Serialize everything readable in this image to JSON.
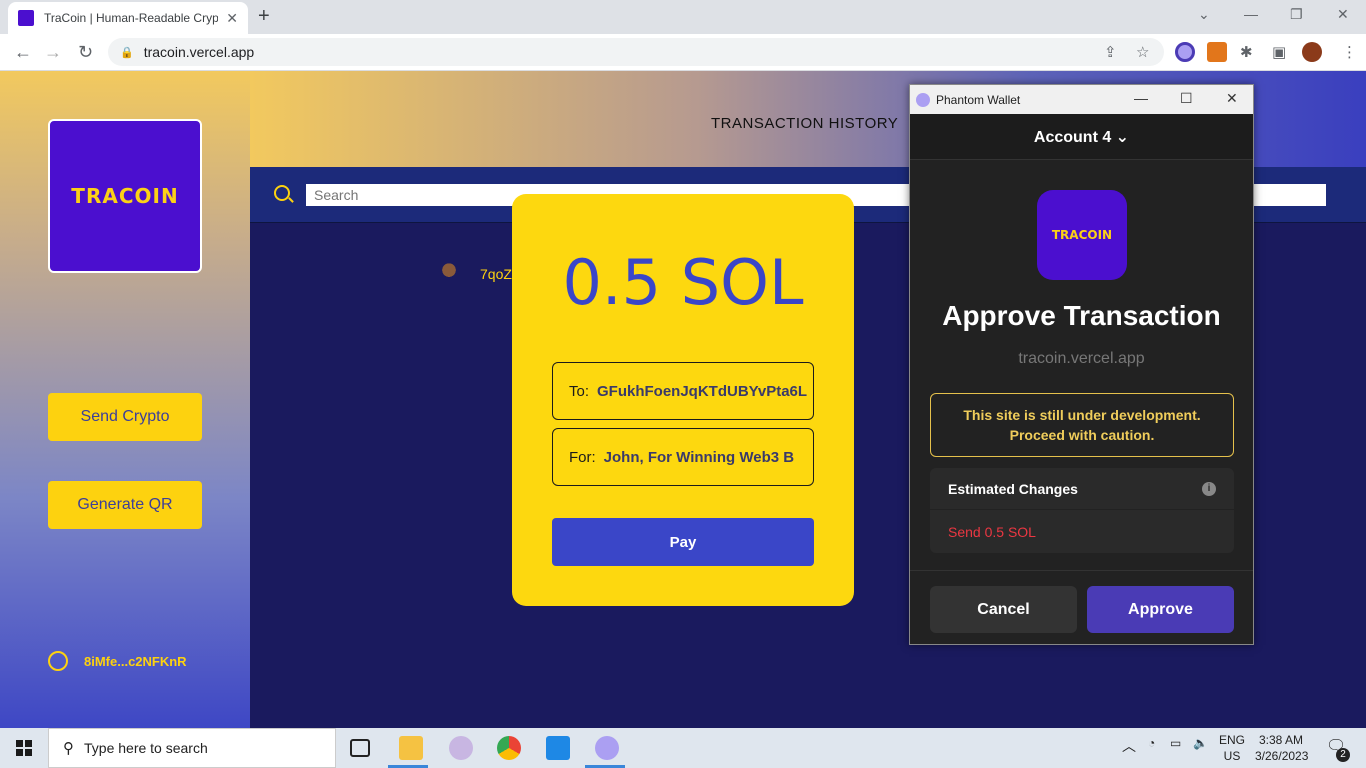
{
  "browser": {
    "tab_title": "TraCoin | Human-Readable Crypto",
    "tab_close": "✕",
    "new_tab": "+",
    "url": "tracoin.vercel.app"
  },
  "sidebar": {
    "logo_text": "TRACOIN",
    "send_crypto": "Send Crypto",
    "generate_qr": "Generate QR",
    "wallet_address": "8iMfe...c2NFKnR"
  },
  "header": {
    "title": "TRANSACTION HISTORY"
  },
  "search": {
    "placeholder": "Search"
  },
  "history": {
    "item_text": "7qoZ"
  },
  "payment": {
    "amount": "0.5 SOL",
    "to_label": "To:",
    "to_value": "GFukhFoenJqKTdUBYvPta6L",
    "for_label": "For:",
    "for_value": "John, For Winning Web3 B",
    "pay_button": "Pay"
  },
  "phantom": {
    "window_title": "Phantom Wallet",
    "account": "Account 4 ⌄",
    "app_logo": "TRACOIN",
    "heading": "Approve Transaction",
    "domain": "tracoin.vercel.app",
    "warning_line1": "This site is still under development.",
    "warning_line2": "Proceed with caution.",
    "changes_title": "Estimated Changes",
    "change_item": "Send 0.5 SOL",
    "cancel": "Cancel",
    "approve": "Approve"
  },
  "taskbar": {
    "search_text": "Type here to search",
    "lang_line1": "ENG",
    "lang_line2": "US",
    "time": "3:38 AM",
    "date": "3/26/2023",
    "notification_count": "2"
  },
  "colors": {
    "brand_purple": "#4b0fcf",
    "brand_yellow": "#fdd20f",
    "pay_blue": "#3a46c8",
    "approve_purple": "#4a3bb5",
    "warning_yellow": "#f0cd5b",
    "send_red": "#eb3742"
  }
}
